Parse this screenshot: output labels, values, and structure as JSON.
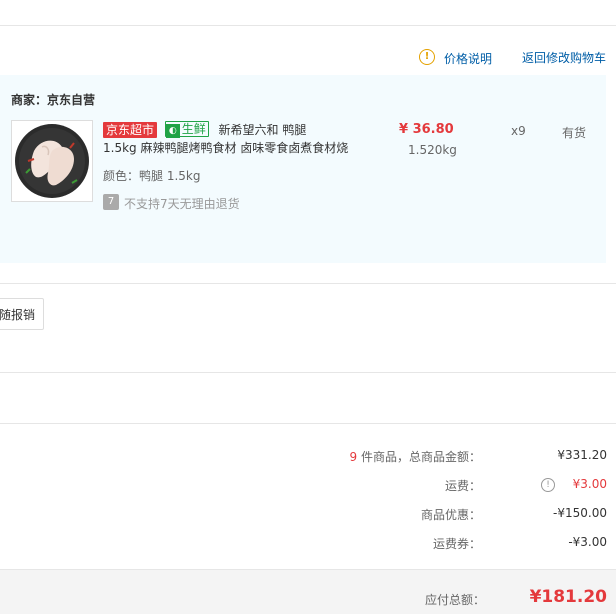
{
  "top_links": {
    "price_info_label": "价格说明",
    "back_to_cart_label": "返回修改购物车"
  },
  "merchant": {
    "label": "商家：京东自营"
  },
  "product": {
    "badge_jd": "京东超市",
    "badge_fresh": "生鲜",
    "title_line1": "新希望六和 鸭腿",
    "title_line2": "1.5kg 麻辣鸭腿烤鸭食材 卤味零食卤煮食材烧",
    "color_label": "颜色：",
    "color_value": "鸭腿 1.5kg",
    "no_return_icon_text": "7",
    "no_return_text": "不支持7天无理由退货",
    "price": "¥ 36.80",
    "weight": "1.520kg",
    "quantity": "x9",
    "stock": "有货"
  },
  "invoice": {
    "button_label": "随报销"
  },
  "summary": {
    "count": "9",
    "count_suffix": " 件商品，总商品金额：",
    "goods_total": "¥331.20",
    "shipping_label": "运费：",
    "shipping_value": "¥3.00",
    "discount_label": "商品优惠：",
    "discount_value": "-¥150.00",
    "coupon_label": "运费券：",
    "coupon_value": "-¥3.00"
  },
  "total": {
    "label": "应付总额：",
    "value": "¥181.20"
  },
  "colors": {
    "accent_red": "#e4393c",
    "link_blue": "#005ea7",
    "fresh_green": "#20a346",
    "product_bg": "#f3fbfe"
  }
}
